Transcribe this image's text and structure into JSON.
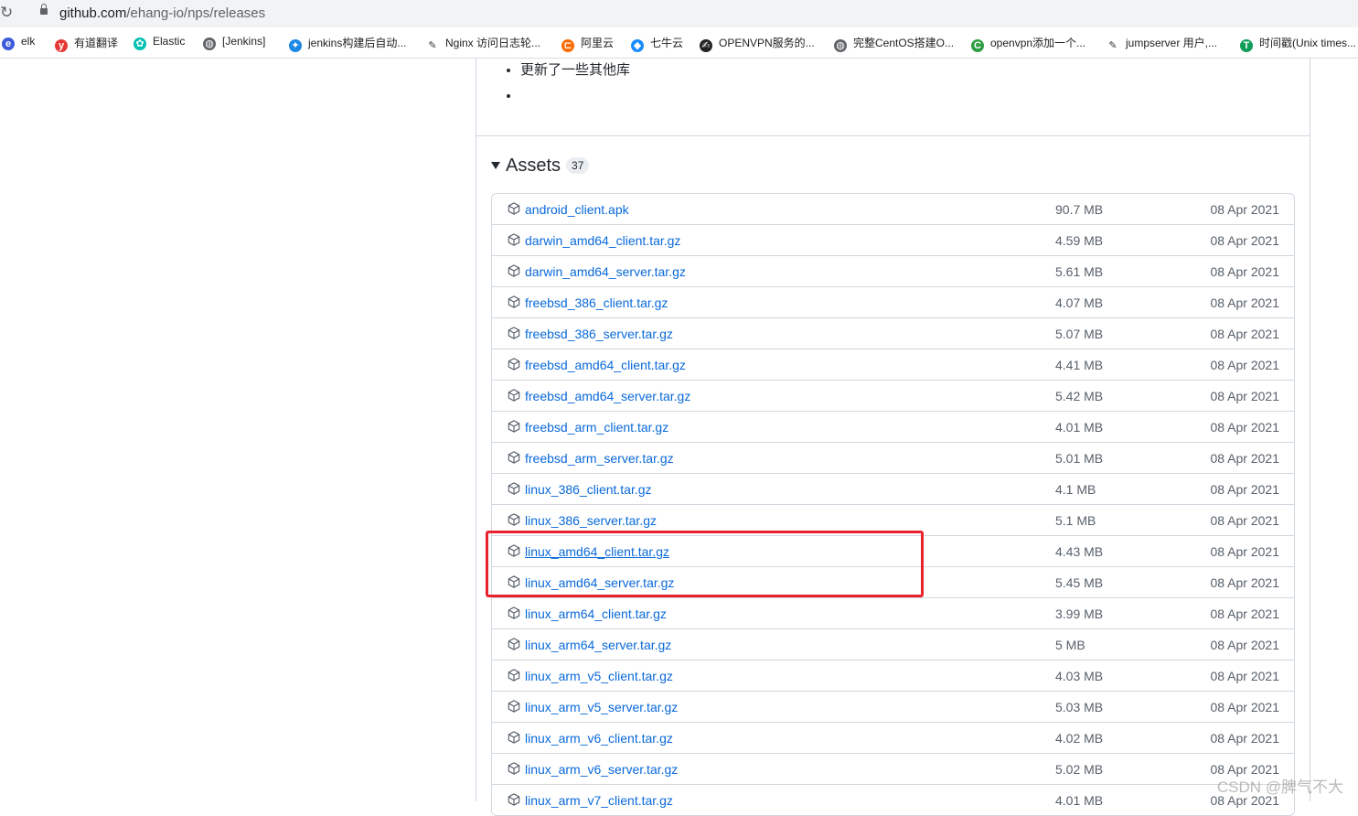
{
  "browser": {
    "url_host": "github.com",
    "url_path": "/ehang-io/nps/releases",
    "bookmarks": [
      {
        "label": "elk",
        "icon": "elk-icon",
        "color": "#3b5bdb",
        "glyph": "e"
      },
      {
        "label": "有道翻译",
        "icon": "youdao-icon",
        "color": "#e53935",
        "glyph": "y"
      },
      {
        "label": "Elastic",
        "icon": "elastic-icon",
        "color": "#00bfb3",
        "glyph": "✿"
      },
      {
        "label": "[Jenkins]",
        "icon": "globe-icon",
        "color": "#5f6368",
        "glyph": "◍"
      },
      {
        "label": "jenkins构建后自动...",
        "icon": "bird-icon",
        "color": "#1e88e5",
        "glyph": "✦"
      },
      {
        "label": "Nginx 访问日志轮...",
        "icon": "feather-icon",
        "color": "#ffffff",
        "glyph": "✎"
      },
      {
        "label": "阿里云",
        "icon": "aliyun-icon",
        "color": "#ff6a00",
        "glyph": "⊏"
      },
      {
        "label": "七牛云",
        "icon": "qiniu-icon",
        "color": "#1a8cff",
        "glyph": "◆"
      },
      {
        "label": "OPENVPN服务的...",
        "icon": "csdn-icon",
        "color": "#222222",
        "glyph": "✍"
      },
      {
        "label": "完整CentOS搭建O...",
        "icon": "globe-icon",
        "color": "#5f6368",
        "glyph": "◍"
      },
      {
        "label": "openvpn添加一个...",
        "icon": "chrome-c-icon",
        "color": "#2e9e44",
        "glyph": "C"
      },
      {
        "label": "jumpserver 用户,...",
        "icon": "feather-icon",
        "color": "#ffffff",
        "glyph": "✎"
      },
      {
        "label": "时间戳(Unix times...",
        "icon": "sheet-icon",
        "color": "#0f9d58",
        "glyph": "T"
      }
    ]
  },
  "release_notes": {
    "items": [
      "更新了一些其他库",
      ""
    ]
  },
  "assets": {
    "title": "Assets",
    "count": "37",
    "rows": [
      {
        "name": "android_client.apk",
        "size": "90.7 MB",
        "date": "08 Apr 2021"
      },
      {
        "name": "darwin_amd64_client.tar.gz",
        "size": "4.59 MB",
        "date": "08 Apr 2021"
      },
      {
        "name": "darwin_amd64_server.tar.gz",
        "size": "5.61 MB",
        "date": "08 Apr 2021"
      },
      {
        "name": "freebsd_386_client.tar.gz",
        "size": "4.07 MB",
        "date": "08 Apr 2021"
      },
      {
        "name": "freebsd_386_server.tar.gz",
        "size": "5.07 MB",
        "date": "08 Apr 2021"
      },
      {
        "name": "freebsd_amd64_client.tar.gz",
        "size": "4.41 MB",
        "date": "08 Apr 2021"
      },
      {
        "name": "freebsd_amd64_server.tar.gz",
        "size": "5.42 MB",
        "date": "08 Apr 2021"
      },
      {
        "name": "freebsd_arm_client.tar.gz",
        "size": "4.01 MB",
        "date": "08 Apr 2021"
      },
      {
        "name": "freebsd_arm_server.tar.gz",
        "size": "5.01 MB",
        "date": "08 Apr 2021"
      },
      {
        "name": "linux_386_client.tar.gz",
        "size": "4.1 MB",
        "date": "08 Apr 2021"
      },
      {
        "name": "linux_386_server.tar.gz",
        "size": "5.1 MB",
        "date": "08 Apr 2021"
      },
      {
        "name": "linux_amd64_client.tar.gz",
        "size": "4.43 MB",
        "date": "08 Apr 2021",
        "hovered": true
      },
      {
        "name": "linux_amd64_server.tar.gz",
        "size": "5.45 MB",
        "date": "08 Apr 2021"
      },
      {
        "name": "linux_arm64_client.tar.gz",
        "size": "3.99 MB",
        "date": "08 Apr 2021"
      },
      {
        "name": "linux_arm64_server.tar.gz",
        "size": "5 MB",
        "date": "08 Apr 2021"
      },
      {
        "name": "linux_arm_v5_client.tar.gz",
        "size": "4.03 MB",
        "date": "08 Apr 2021"
      },
      {
        "name": "linux_arm_v5_server.tar.gz",
        "size": "5.03 MB",
        "date": "08 Apr 2021"
      },
      {
        "name": "linux_arm_v6_client.tar.gz",
        "size": "4.02 MB",
        "date": "08 Apr 2021"
      },
      {
        "name": "linux_arm_v6_server.tar.gz",
        "size": "5.02 MB",
        "date": "08 Apr 2021"
      },
      {
        "name": "linux_arm_v7_client.tar.gz",
        "size": "4.01 MB",
        "date": "08 Apr 2021"
      }
    ]
  },
  "annotation": {
    "highlight_color": "#e8222b"
  },
  "watermark": "CSDN @脾气不大"
}
